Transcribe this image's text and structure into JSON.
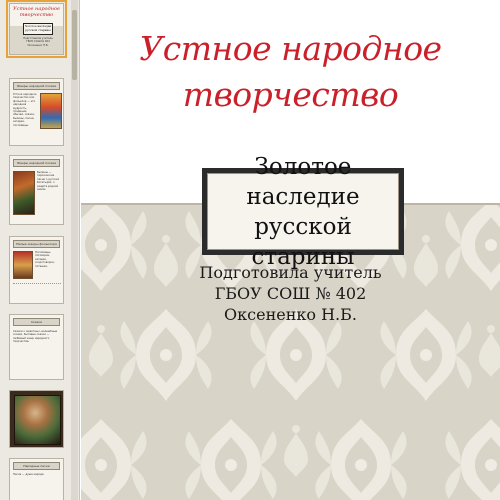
{
  "slide": {
    "title_line1": "Устное народное",
    "title_line2": "творчество",
    "subtitle_line1": "Золотое наследие",
    "subtitle_line2": "русской старины",
    "author_line1": "Подготовила учитель",
    "author_line2": "ГБОУ СОШ № 402",
    "author_line3": "Оксененко Н.Б."
  },
  "thumbnails": {
    "t1": {
      "title": "Устное народное творчество",
      "box": "Золотое наследие русской старины",
      "author": "Подготовила учитель ГБОУ СОШ № 402 Оксененко Н.Б."
    },
    "t2": {
      "heading": "Жанры народной поэзии",
      "text": "Устное народное творчество или фольклор — это народная мудрость, традиции, обычаи, сказки, былины, песни, загадки, пословицы."
    },
    "t3": {
      "heading": "Жанры народной поэзии",
      "text": "Былины — героические песни о русских богатырях, о защите родной земли."
    },
    "t4": {
      "heading": "Малые жанры фольклора",
      "text": "Пословицы, поговорки, загадки, скороговорки, потешки."
    },
    "t5": {
      "heading": "Сказки",
      "text": "Сказки о животных, волшебные сказки, бытовые сказки — любимый жанр народного творчества."
    },
    "t7": {
      "heading": "Народные песни",
      "text": "Песня — душа народа."
    }
  },
  "colors": {
    "title_red": "#c9202a",
    "pattern_bg": "#d9d4c8",
    "pattern_motif": "#f4f1ea",
    "selected_outline": "#e7a33b"
  }
}
